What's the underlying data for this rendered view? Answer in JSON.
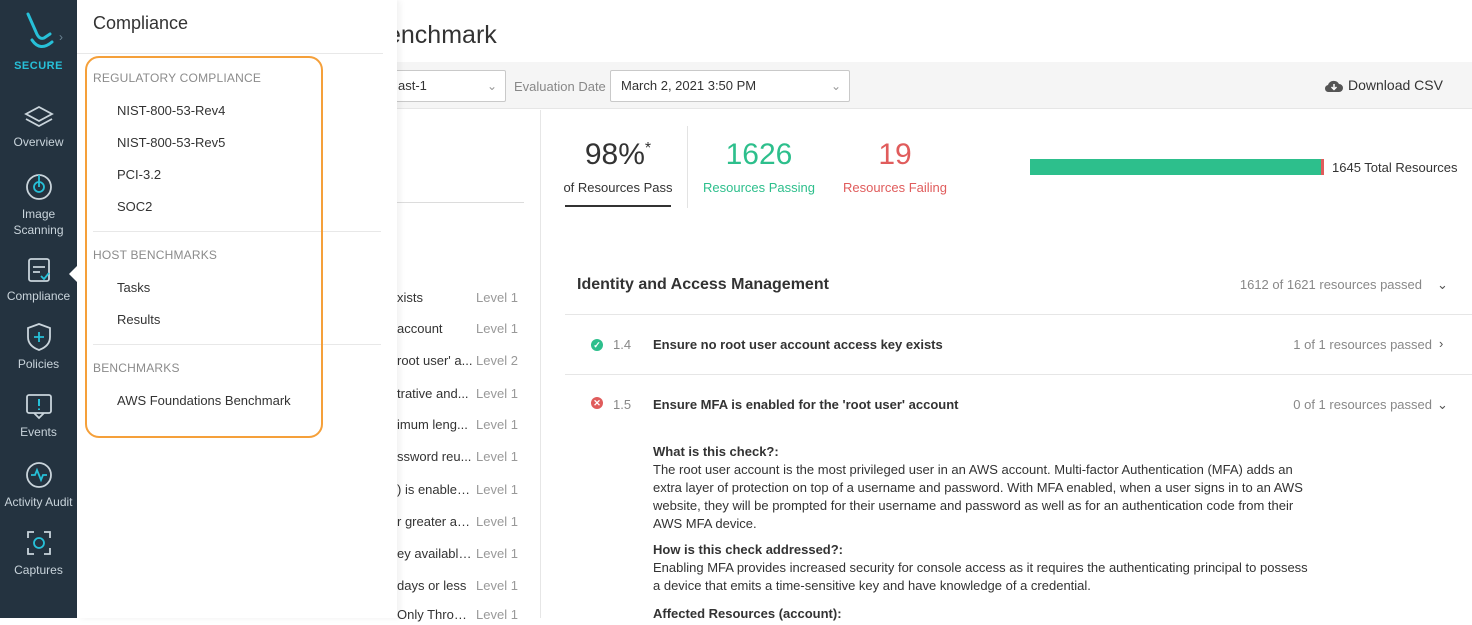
{
  "nav": {
    "brand": "SECURE",
    "items": [
      {
        "label": "Overview",
        "icon": "layers-icon"
      },
      {
        "label": "Image Scanning",
        "icon": "scan-icon"
      },
      {
        "label": "Compliance",
        "icon": "clipboard-check-icon"
      },
      {
        "label": "Policies",
        "icon": "shield-plus-icon"
      },
      {
        "label": "Events",
        "icon": "alert-message-icon"
      },
      {
        "label": "Activity Audit",
        "icon": "activity-icon"
      },
      {
        "label": "Captures",
        "icon": "capture-icon"
      }
    ]
  },
  "flyout": {
    "title": "Compliance",
    "sections": [
      {
        "header": "REGULATORY COMPLIANCE",
        "items": [
          "NIST-800-53-Rev4",
          "NIST-800-53-Rev5",
          "PCI-3.2",
          "SOC2"
        ]
      },
      {
        "header": "HOST BENCHMARKS",
        "items": [
          "Tasks",
          "Results"
        ]
      },
      {
        "header": "BENCHMARKS",
        "items": [
          "AWS Foundations Benchmark"
        ]
      }
    ]
  },
  "page": {
    "title": "enchmark",
    "region_value": "ast-1",
    "evaluation_label": "Evaluation Date",
    "evaluation_value": "March 2, 2021 3:50 PM",
    "download_label": "Download CSV"
  },
  "left_list": [
    {
      "text": "xists",
      "level": "Level 1"
    },
    {
      "text": "account",
      "level": "Level 1"
    },
    {
      "text": "root user' a...",
      "level": "Level 2"
    },
    {
      "text": "trative and...",
      "level": "Level 1"
    },
    {
      "text": "imum leng...",
      "level": "Level 1"
    },
    {
      "text": "ssword reu...",
      "level": "Level 1"
    },
    {
      "text": ") is enabled ...",
      "level": "Level 1"
    },
    {
      "text": "r greater are...",
      "level": "Level 1"
    },
    {
      "text": "ey available ...",
      "level": "Level 1"
    },
    {
      "text": " days or less",
      "level": "Level 1"
    },
    {
      "text": "Only Throug...",
      "level": "Level 1"
    }
  ],
  "summary": {
    "pass_pct": "98%",
    "pass_pct_asterisk": "*",
    "pass_pct_label": "of Resources Pass",
    "passing": "1626",
    "passing_label": "Resources Passing",
    "failing": "19",
    "failing_label": "Resources Failing",
    "total_label": "1645 Total Resources",
    "passing_count": 1626,
    "failing_count": 19,
    "colors": {
      "pass": "#2dbf8c",
      "fail": "#e05c5c"
    }
  },
  "section": {
    "title": "Identity and Access Management",
    "count": "1612 of 1621 resources passed"
  },
  "checks": [
    {
      "num": "1.4",
      "title": "Ensure no root user account access key exists",
      "count": "1 of 1 resources passed",
      "status": "pass"
    },
    {
      "num": "1.5",
      "title": "Ensure MFA is enabled for the 'root user' account",
      "count": "0 of 1 resources passed",
      "status": "fail"
    }
  ],
  "detail": {
    "what_h": "What is this check?:",
    "what_body": "The root user account is the most privileged user in an AWS account. Multi-factor Authentication (MFA) adds an extra layer of protection on top of a username and password. With MFA enabled, when a user signs in to an AWS website, they will be prompted for their username and password as well as for an authentication code from their AWS MFA device.",
    "how_h": "How is this check addressed?:",
    "how_body": "Enabling MFA provides increased security for console access as it requires the authenticating principal to possess a device that emits a time-sensitive key and have knowledge of a credential.",
    "affected_h": "Affected Resources (account):"
  }
}
